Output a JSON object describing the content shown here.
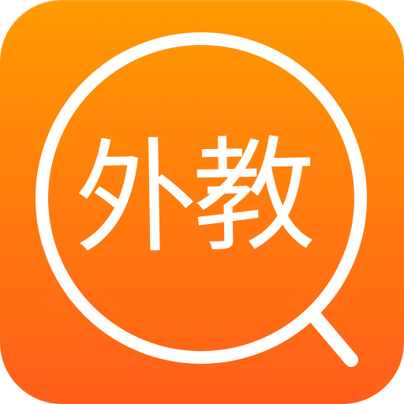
{
  "icon": {
    "text": "外教",
    "icon_name": "magnifying-glass-icon",
    "background_colors": [
      "#ff9a00",
      "#ff7d0d",
      "#ff5e1a"
    ],
    "foreground_color": "#ffffff"
  }
}
